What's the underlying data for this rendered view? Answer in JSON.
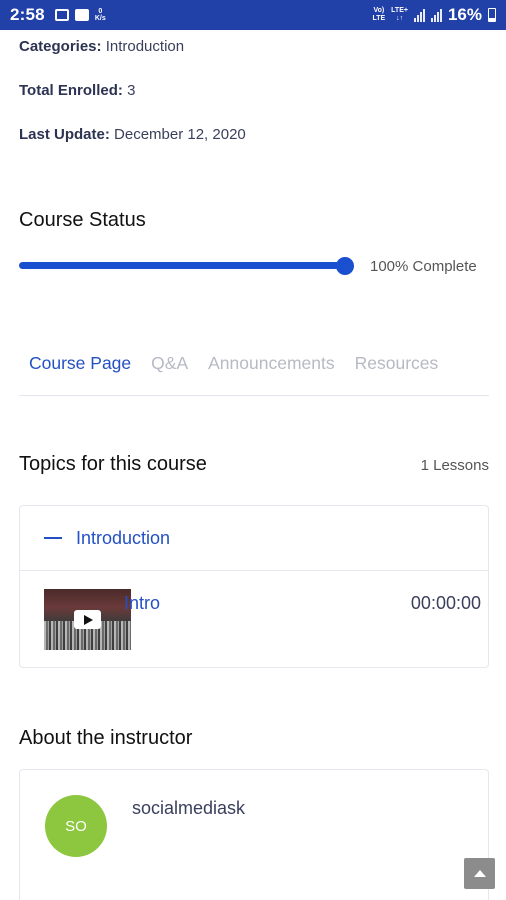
{
  "status_bar": {
    "time": "2:58",
    "kbps_value": "0",
    "kbps_unit": "K/s",
    "lte1": "Vo)",
    "lte2": "LTE",
    "lte3": "LTE+",
    "lte4": "↓↑",
    "battery": "16%"
  },
  "course_meta": {
    "categories_label": "Categories:",
    "categories_value": "Introduction",
    "enrolled_label": "Total Enrolled:",
    "enrolled_value": "3",
    "update_label": "Last Update:",
    "update_value": "December 12, 2020"
  },
  "course_status": {
    "heading": "Course Status",
    "progress": 1.0,
    "progress_text": "100% Complete"
  },
  "tabs": [
    {
      "label": "Course Page",
      "active": true
    },
    {
      "label": "Q&A",
      "active": false
    },
    {
      "label": "Announcements",
      "active": false
    },
    {
      "label": "Resources",
      "active": false
    }
  ],
  "topics": {
    "heading": "Topics for this course",
    "count_text": "1 Lessons",
    "topic_title": "Introduction",
    "lesson": {
      "title": "Intro",
      "duration": "00:00:00"
    }
  },
  "instructor": {
    "heading": "About the instructor",
    "initials": "SO",
    "name": "socialmediask"
  },
  "colors": {
    "status_bar": "#2140a8",
    "accent": "#2450c5",
    "avatar": "#8dc63f"
  }
}
